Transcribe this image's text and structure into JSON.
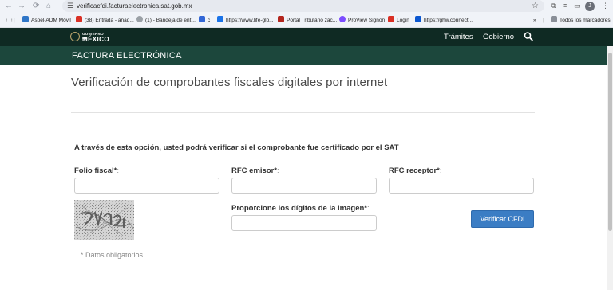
{
  "browser": {
    "url": "verificacfdi.facturaelectronica.sat.gob.mx",
    "avatar_letter": "J",
    "bookmarks": [
      {
        "label": "Aspel-ADM Móvil",
        "color": "#2f76c7"
      },
      {
        "label": "(38) Entrada - anad...",
        "color": "#d93025"
      },
      {
        "label": "(1) - Bandeja de ent...",
        "color": "#9aa0a6"
      },
      {
        "label": "c",
        "color": "#3367d6"
      },
      {
        "label": "https://www.life-glo...",
        "color": "#1a73e8"
      },
      {
        "label": "Portal Tributario zac...",
        "color": "#b3261e"
      },
      {
        "label": "ProView Signon",
        "color": "#7c4dff"
      },
      {
        "label": "Login",
        "color": "#d93025"
      },
      {
        "label": "https://ghw.connect...",
        "color": "#0b57d0"
      }
    ],
    "all_bookmarks_label": "Todos los marcadores"
  },
  "gob_header": {
    "logo_line1": "GOBIERNO DE",
    "logo_line2": "MÉXICO",
    "links": [
      "Trámites",
      "Gobierno"
    ]
  },
  "band": {
    "title": "FACTURA ELECTRÓNICA"
  },
  "page": {
    "title": "Verificación de comprobantes fiscales digitales por internet",
    "intro": "A través de esta opción, usted podrá verificar si el comprobante fue certificado por el SAT",
    "fields": {
      "folio": {
        "label": "Folio fiscal*",
        "value": ""
      },
      "rfc_emisor": {
        "label": "RFC emisor*",
        "value": ""
      },
      "rfc_receptor": {
        "label": "RFC receptor*",
        "value": ""
      },
      "captcha_digits": {
        "label": "Proporcione los dígitos de la imagen*",
        "value": ""
      }
    },
    "verify_button": "Verificar CFDI",
    "required_note": "* Datos obligatorios"
  },
  "colors": {
    "gob_header": "#0f2a23",
    "band": "#1c473c",
    "button": "#3b7dc4"
  }
}
